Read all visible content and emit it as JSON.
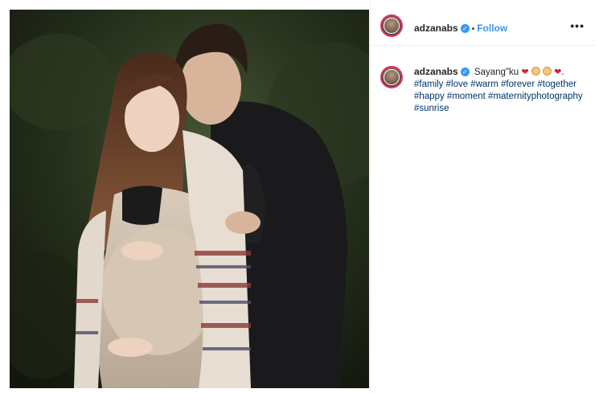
{
  "post": {
    "author": {
      "username": "adzanabs",
      "follow_label": "Follow",
      "separator": "•"
    },
    "more_label": "•••",
    "caption": {
      "username": "adzanabs",
      "text": "Sayang\"ku",
      "emoji": [
        "red-heart",
        "baby-face",
        "baby-face",
        "red-heart"
      ],
      "trailing": ".",
      "hashtags": "#family #love #warm #forever #together #happy #moment #maternityphotography #sunrise"
    },
    "colors": {
      "accent": "#3897f0",
      "hashtag": "#003569",
      "avatar_ring": "#e1306c"
    }
  }
}
